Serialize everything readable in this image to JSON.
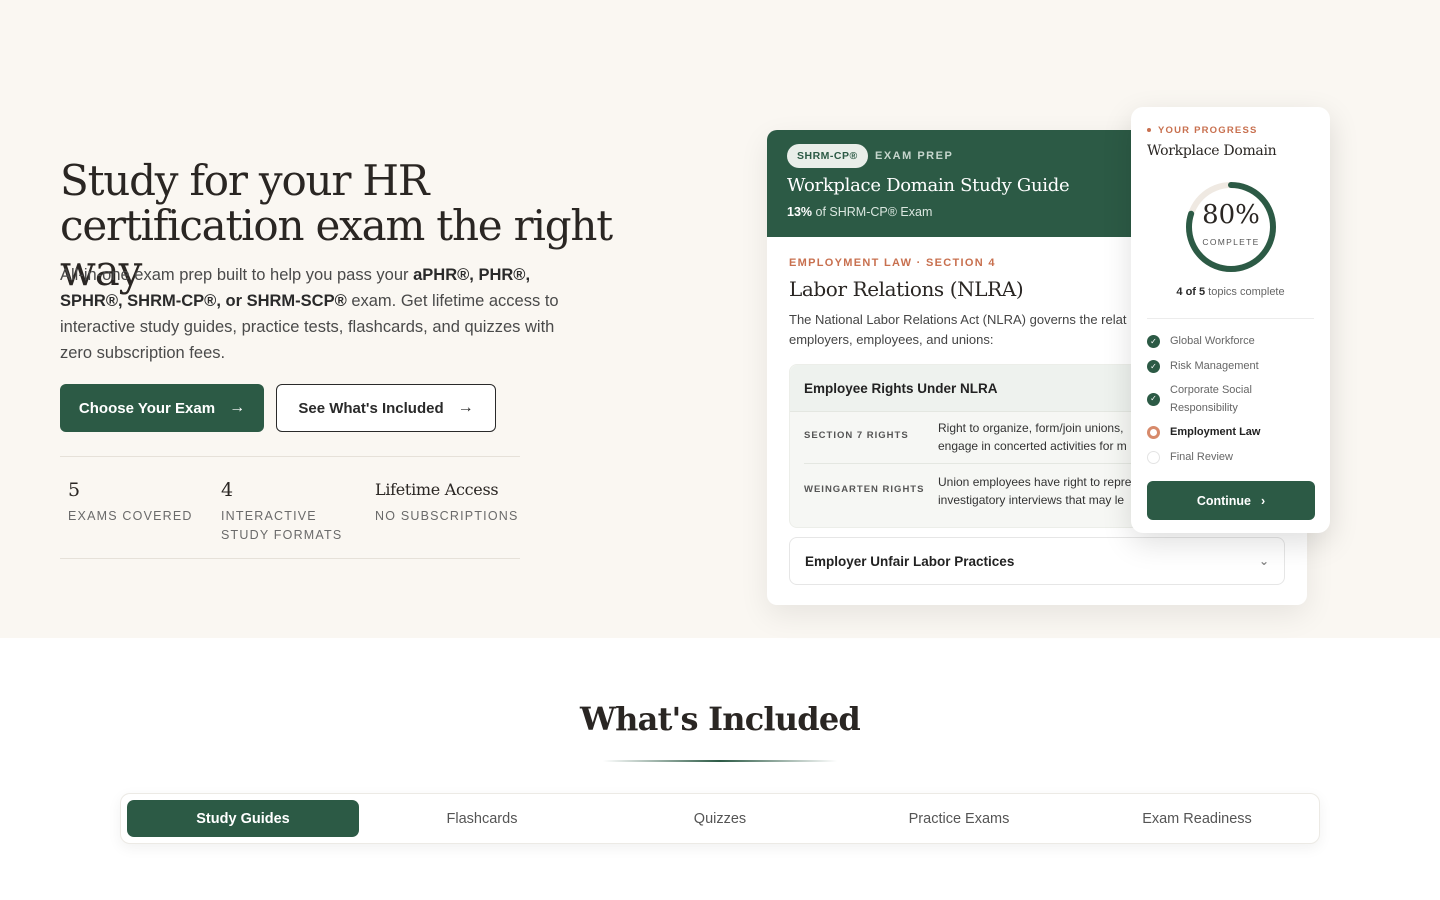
{
  "hero": {
    "title": "Study for your HR certification exam the right way",
    "desc_prefix": "All-in-one exam prep built to help you pass your ",
    "desc_bold": "aPHR®, PHR®, SPHR®, SHRM-CP®, or SHRM-SCP®",
    "desc_suffix": " exam. Get lifetime access to interactive study guides, practice tests, flashcards, and quizzes with zero subscription fees.",
    "primary_button": "Choose Your Exam",
    "secondary_button": "See What's Included",
    "arrow_icon": "→",
    "stats": [
      {
        "value": "5",
        "label": "EXAMS COVERED"
      },
      {
        "value": "4",
        "label": "INTERACTIVE STUDY FORMATS"
      },
      {
        "value": "Lifetime Access",
        "label": "NO SUBSCRIPTIONS"
      }
    ]
  },
  "guide_card": {
    "badge": "SHRM-CP®",
    "tag": "EXAM PREP",
    "title": "Workplace Domain Study Guide",
    "weight_pct": "13%",
    "weight_suffix": " of SHRM-CP® Exam",
    "section_tag": "EMPLOYMENT LAW · SECTION 4",
    "section_title": "Labor Relations (NLRA)",
    "section_desc_line1": "The National Labor Relations Act (NLRA) governs the relat",
    "section_desc_line2": "employers, employees, and unions:",
    "accordion_open": {
      "title": "Employee Rights Under NLRA",
      "rows": [
        {
          "key": "SECTION 7 RIGHTS",
          "line1": "Right to organize, form/join unions,",
          "line2": "engage in concerted activities for m"
        },
        {
          "key": "WEINGARTEN RIGHTS",
          "line1": "Union employees have right to repre",
          "line2": "investigatory interviews that may le"
        }
      ]
    },
    "accordion_closed": {
      "title": "Employer Unfair Labor Practices",
      "icon": "⌄"
    }
  },
  "progress_card": {
    "tag": "YOUR PROGRESS",
    "title": "Workplace Domain",
    "percent": 80,
    "percent_label": "80%",
    "complete_label": "COMPLETE",
    "count_bold": "4 of 5",
    "count_suffix": " topics complete",
    "topics": [
      {
        "label": "Global Workforce",
        "status": "done"
      },
      {
        "label": "Risk Management",
        "status": "done"
      },
      {
        "label": "Corporate Social Responsibility",
        "status": "done"
      },
      {
        "label": "Employment Law",
        "status": "current"
      },
      {
        "label": "Final Review",
        "status": "pending"
      }
    ],
    "check_icon": "✓",
    "continue_label": "Continue",
    "continue_icon": "›"
  },
  "included": {
    "title": "What's Included",
    "tabs": [
      "Study Guides",
      "Flashcards",
      "Quizzes",
      "Practice Exams",
      "Exam Readiness"
    ],
    "active_tab": 0
  },
  "colors": {
    "brand_green": "#2c5a45",
    "accent_orange": "#c8704f",
    "hero_bg": "#faf7f2"
  }
}
